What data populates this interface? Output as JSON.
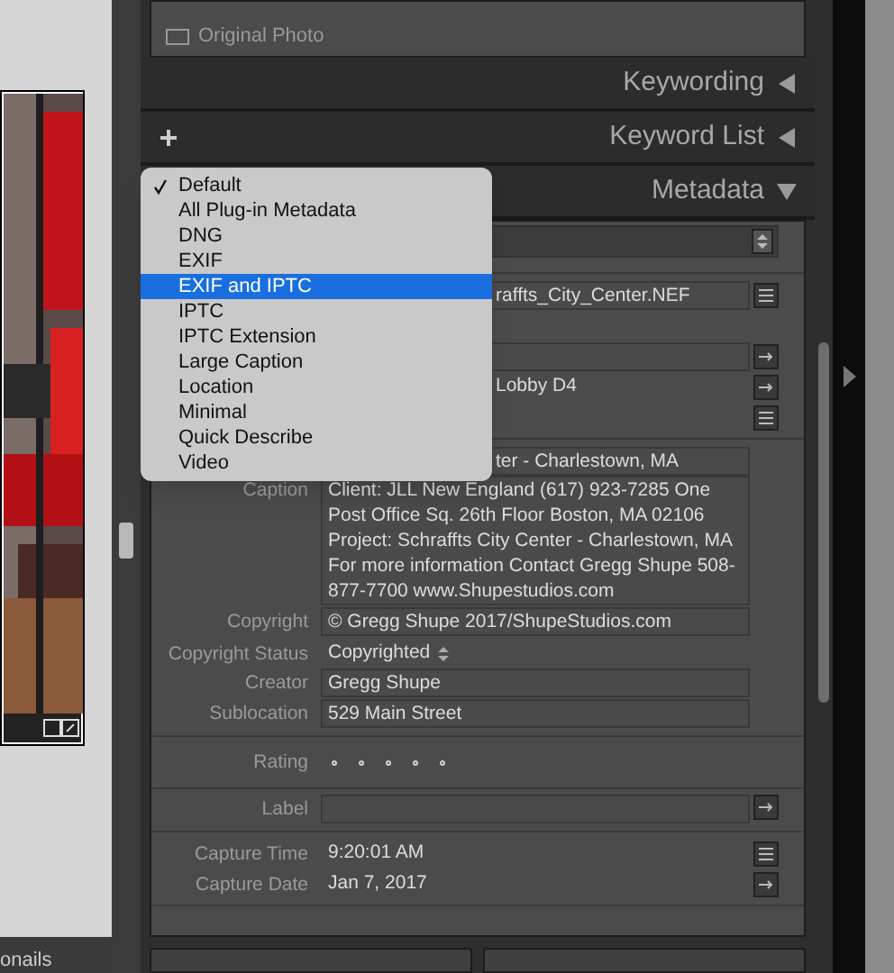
{
  "original_photo": {
    "label": "Original Photo",
    "checked": false
  },
  "sections": [
    {
      "title": "Keywording",
      "expanded": false,
      "add_button": false
    },
    {
      "title": "Keyword List",
      "expanded": false,
      "add_button": true
    },
    {
      "title": "Metadata",
      "expanded": true,
      "add_button": false
    }
  ],
  "preset_menu": {
    "items": [
      {
        "label": "Default",
        "checked": true,
        "selected": false
      },
      {
        "label": "All Plug-in Metadata",
        "checked": false,
        "selected": false
      },
      {
        "label": "DNG",
        "checked": false,
        "selected": false
      },
      {
        "label": "EXIF",
        "checked": false,
        "selected": false
      },
      {
        "label": "EXIF and IPTC",
        "checked": false,
        "selected": true
      },
      {
        "label": "IPTC",
        "checked": false,
        "selected": false
      },
      {
        "label": "IPTC Extension",
        "checked": false,
        "selected": false
      },
      {
        "label": "Large Caption",
        "checked": false,
        "selected": false
      },
      {
        "label": "Location",
        "checked": false,
        "selected": false
      },
      {
        "label": "Minimal",
        "checked": false,
        "selected": false
      },
      {
        "label": "Quick Describe",
        "checked": false,
        "selected": false
      },
      {
        "label": "Video",
        "checked": false,
        "selected": false
      }
    ]
  },
  "metadata": {
    "groups": [
      [
        {
          "kind": "covered_field",
          "value": "raffts_City_Center.NEF",
          "list_button": true
        },
        {
          "kind": "gap"
        },
        {
          "kind": "covered_field",
          "arrow_button": true
        },
        {
          "kind": "covered_text",
          "value": "Lobby D4",
          "arrow_button": true
        },
        {
          "kind": "covered_text",
          "list_button": true
        }
      ],
      [
        {
          "kind": "covered_field",
          "value": "ter  - Charlestown, MA"
        },
        {
          "kind": "field",
          "label": "Caption",
          "value": "Client: JLL New England (617) 923-7285 One Post Office Sq. 26th Floor Boston, MA 02106 Project: Schraffts City Center - Charlestown, MA For more information Contact Gregg Shupe 508-877-7700 www.Shupestudios.com"
        },
        {
          "kind": "field",
          "label": "Copyright",
          "value": "© Gregg Shupe 2017/ShupeStudios.com"
        },
        {
          "kind": "status",
          "label": "Copyright Status",
          "value": "Copyrighted"
        },
        {
          "kind": "field",
          "label": "Creator",
          "value": "Gregg Shupe"
        },
        {
          "kind": "field",
          "label": "Sublocation",
          "value": "529 Main Street"
        }
      ],
      [
        {
          "kind": "rating",
          "label": "Rating",
          "stars": 0
        }
      ],
      [
        {
          "kind": "field",
          "label": "Label",
          "arrow_button": true
        }
      ],
      [
        {
          "kind": "text",
          "label": "Capture Time",
          "value": "9:20:01 AM",
          "list_button": true
        },
        {
          "kind": "text",
          "label": "Capture Date",
          "value": "Jan 7, 2017",
          "arrow_button": true
        }
      ]
    ]
  },
  "filmstrip_label": "onails"
}
